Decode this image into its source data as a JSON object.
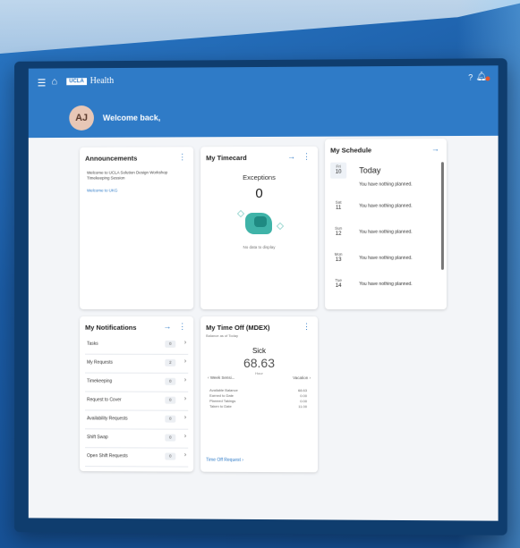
{
  "header": {
    "brand_box": "UCLA",
    "brand_name": "Health",
    "avatar_initials": "AJ",
    "welcome": "Welcome back,"
  },
  "announcements": {
    "title": "Announcements",
    "text": "Welcome to UCLA Solution Design Workshop Timekeeping Session",
    "link": "Welcome to UKG"
  },
  "timecard": {
    "title": "My Timecard",
    "exceptions_label": "Exceptions",
    "exceptions_value": "0",
    "no_data": "No data to display"
  },
  "schedule": {
    "title": "My Schedule",
    "today": {
      "dow": "Fri",
      "day": "10",
      "label": "Today",
      "text": "You have nothing planned."
    },
    "days": [
      {
        "dow": "Sat",
        "day": "11",
        "text": "You have nothing planned."
      },
      {
        "dow": "Sun",
        "day": "12",
        "text": "You have nothing planned."
      },
      {
        "dow": "Mon",
        "day": "13",
        "text": "You have nothing planned."
      },
      {
        "dow": "Tue",
        "day": "14",
        "text": "You have nothing planned."
      }
    ]
  },
  "notifications": {
    "title": "My Notifications",
    "items": [
      {
        "label": "Tasks",
        "count": "0"
      },
      {
        "label": "My Requests",
        "count": "2"
      },
      {
        "label": "Timekeeping",
        "count": "0"
      },
      {
        "label": "Request to Cover",
        "count": "0"
      },
      {
        "label": "Availability Requests",
        "count": "0"
      },
      {
        "label": "Shift Swap",
        "count": "0"
      },
      {
        "label": "Open Shift Requests",
        "count": "0"
      }
    ]
  },
  "timeoff": {
    "title": "My Time Off (MDEX)",
    "balance_as_of": "Balance as of Today",
    "type": "Sick",
    "value": "68.63",
    "unit": "Hour",
    "nav_left": "Week Sensi...",
    "nav_right": "Vacation",
    "rows": [
      {
        "label": "Available Balance",
        "value": "68.63"
      },
      {
        "label": "Earned to Date",
        "value": "0.00"
      },
      {
        "label": "Planned Takings",
        "value": "0.00"
      },
      {
        "label": "Taken to Date",
        "value": "11.00"
      }
    ],
    "link": "Time Off Request"
  }
}
